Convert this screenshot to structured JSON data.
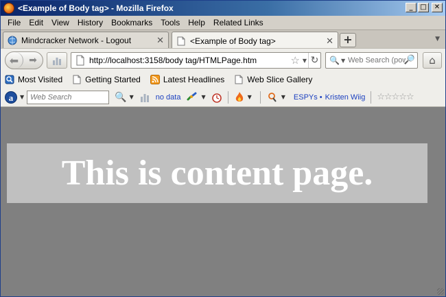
{
  "window": {
    "title": "<Example of Body tag> - Mozilla Firefox",
    "controls": {
      "minimize": "_",
      "maximize": "□",
      "close": "✕"
    }
  },
  "menu": {
    "items": [
      "File",
      "Edit",
      "View",
      "History",
      "Bookmarks",
      "Tools",
      "Help",
      "Related Links"
    ]
  },
  "tabs": [
    {
      "label": "Mindcracker Network - Logout",
      "active": false
    },
    {
      "label": "<Example of Body tag>",
      "active": true
    }
  ],
  "newtab_label": "+",
  "nav": {
    "url": "http://localhost:3158/body tag/HTMLPage.htm",
    "search_placeholder": "Web Search (pow"
  },
  "bookmarks": [
    {
      "label": "Most Visited"
    },
    {
      "label": "Getting Started"
    },
    {
      "label": "Latest Headlines"
    },
    {
      "label": "Web Slice Gallery"
    }
  ],
  "toolbar": {
    "logo": "a",
    "search_placeholder": "Web Search",
    "no_data": "no data",
    "espys": "ESPYs",
    "kristen": "Kristen Wiig",
    "stars": "☆☆☆☆☆"
  },
  "page": {
    "heading": "This is content page."
  }
}
